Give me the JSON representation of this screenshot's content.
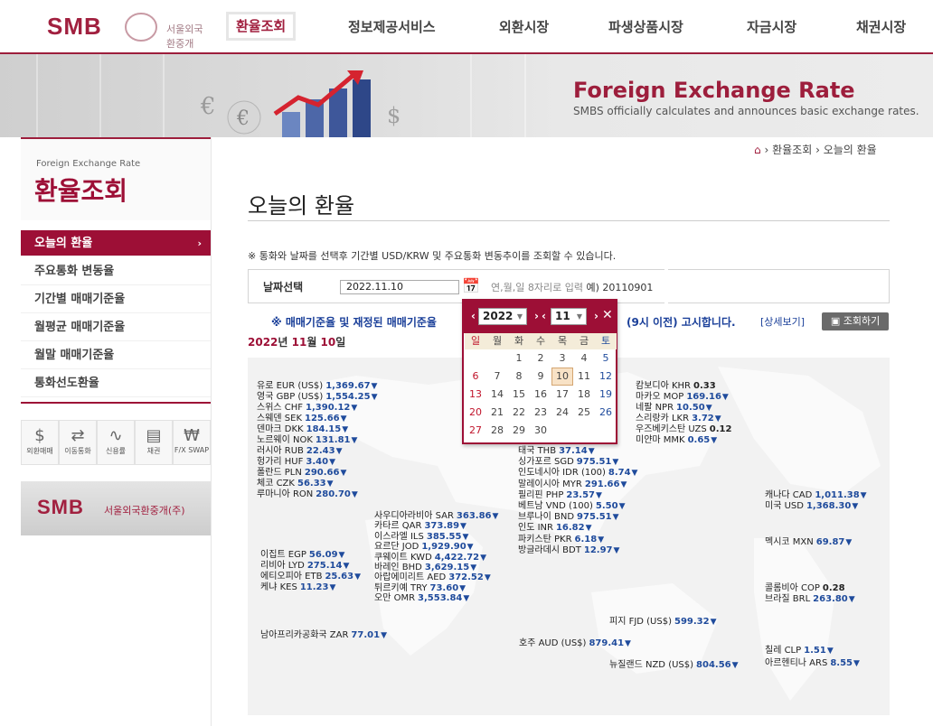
{
  "header": {
    "logo": "SMB",
    "logo_sub": "서울외국환중개",
    "nav": [
      "환율조회",
      "정보제공서비스",
      "외환시장",
      "파생상품시장",
      "자금시장",
      "채권시장"
    ]
  },
  "banner": {
    "title": "Foreign Exchange Rate",
    "subtitle": "SMBS officially calculates and announces basic exchange rates."
  },
  "breadcrumb": [
    "환율조회",
    "오늘의 환율"
  ],
  "sidebar": {
    "head_en": "Foreign Exchange Rate",
    "head_ko": "환율조회",
    "items": [
      "오늘의 환율",
      "주요통화 변동율",
      "기간별 매매기준율",
      "월평균 매매기준율",
      "월말 매매기준율",
      "통화선도환율"
    ],
    "quick": [
      "외환매매",
      "이동통화",
      "신용률",
      "채권",
      "F/X SWAP"
    ],
    "banner_logo": "SMB",
    "banner_text": "서울외국환중개(주)"
  },
  "page_title": "오늘의 환율",
  "note": "※ 통화와 날짜를 선택후 기간별 USD/KRW 및 주요통화 변동추이를 조회할 수 있습니다.",
  "date_select": {
    "label": "날짜선택",
    "value": "2022.11.10",
    "hint_prefix": "연,월,일 8자리로 입력 ",
    "hint_example": "예) 20110901"
  },
  "notice": {
    "text_left": "※ 매매기준율 및 재정된 매매기준율",
    "text_right": "(9시 이전) 고시합니다.",
    "detail_link": "[상세보기]",
    "query_button": "조회하기"
  },
  "date_heading": {
    "y": "2022",
    "y_unit": "년 ",
    "m": "11",
    "m_unit": "월 ",
    "d": "10",
    "d_unit": "일"
  },
  "calendar": {
    "year": "2022",
    "month": "11",
    "dow": [
      "일",
      "월",
      "화",
      "수",
      "목",
      "금",
      "토"
    ],
    "weeks": [
      [
        "",
        "",
        "1",
        "2",
        "3",
        "4",
        "5"
      ],
      [
        "6",
        "7",
        "8",
        "9",
        "10",
        "11",
        "12"
      ],
      [
        "13",
        "14",
        "15",
        "16",
        "17",
        "18",
        "19"
      ],
      [
        "20",
        "21",
        "22",
        "23",
        "24",
        "25",
        "26"
      ],
      [
        "27",
        "28",
        "29",
        "30",
        "",
        "",
        ""
      ]
    ],
    "today": "10"
  },
  "rates": {
    "europe": [
      [
        "유로 EUR (US$)",
        "1,369.67"
      ],
      [
        "영국 GBP (US$)",
        "1,554.25"
      ],
      [
        "스위스 CHF",
        "1,390.12"
      ],
      [
        "스웨덴 SEK",
        "125.66"
      ],
      [
        "덴마크 DKK",
        "184.15"
      ],
      [
        "노르웨이 NOK",
        "131.81"
      ],
      [
        "러시아 RUB",
        "22.43"
      ],
      [
        "헝가리 HUF",
        "3.40"
      ],
      [
        "폴란드 PLN",
        "290.66"
      ],
      [
        "체코 CZK",
        "56.33"
      ],
      [
        "루마니아 RON",
        "280.70"
      ]
    ],
    "middle_east": [
      [
        "사우디아라비아 SAR",
        "363.86"
      ],
      [
        "카타르 QAR",
        "373.89"
      ],
      [
        "이스라엘 ILS",
        "385.55"
      ],
      [
        "요르단 JOD",
        "1,929.90"
      ],
      [
        "쿠웨이트 KWD",
        "4,422.72"
      ],
      [
        "바레인 BHD",
        "3,629.15"
      ],
      [
        "아랍에미리트 AED",
        "372.52"
      ],
      [
        "튀르키예 TRY",
        "73.60"
      ],
      [
        "오만 OMR",
        "3,553.84"
      ]
    ],
    "africa": [
      [
        "이집트 EGP",
        "56.09"
      ],
      [
        "리비아 LYD",
        "275.14"
      ],
      [
        "에티오피아 ETB",
        "25.63"
      ],
      [
        "케냐 KES",
        "11.23"
      ]
    ],
    "south_africa": [
      "남아프리카공화국 ZAR",
      "77.01"
    ],
    "asia_left": [
      [
        "태국 THB",
        "37.14"
      ],
      [
        "싱가포르 SGD",
        "975.51"
      ],
      [
        "인도네시아 IDR (100)",
        "8.74"
      ],
      [
        "말레이시아 MYR",
        "291.66"
      ],
      [
        "필리핀 PHP",
        "23.57"
      ],
      [
        "베트남 VND (100)",
        "5.50"
      ],
      [
        "브루나이 BND",
        "975.51"
      ],
      [
        "인도 INR",
        "16.82"
      ],
      [
        "파키스탄 PKR",
        "6.18"
      ],
      [
        "방글라데시 BDT",
        "12.97"
      ]
    ],
    "asia_right": [
      [
        "캄보디아 KHR",
        "0.33",
        "none"
      ],
      [
        "마카오 MOP",
        "169.16",
        "down"
      ],
      [
        "네팔 NPR",
        "10.50",
        "down"
      ],
      [
        "스리랑카 LKR",
        "3.72",
        "down"
      ],
      [
        "우즈베키스탄 UZS",
        "0.12",
        "none"
      ],
      [
        "미얀마 MMK",
        "0.65",
        "down"
      ]
    ],
    "oceania": [
      [
        "피지 FJD (US$)",
        "599.32"
      ],
      [
        "호주 AUD (US$)",
        "879.41"
      ],
      [
        "뉴질랜드 NZD (US$)",
        "804.56"
      ]
    ],
    "north_america": [
      [
        "캐나다 CAD",
        "1,011.38"
      ],
      [
        "미국 USD",
        "1,368.30"
      ]
    ],
    "mexico": [
      "멕시코 MXN",
      "69.87"
    ],
    "south_america": [
      [
        "콜롬비아 COP",
        "0.28",
        "none"
      ],
      [
        "브라질 BRL",
        "263.80",
        "down"
      ]
    ],
    "chile_argentina": [
      [
        "칠레 CLP",
        "1.51"
      ],
      [
        "아르헨티나 ARS",
        "8.55"
      ]
    ]
  }
}
